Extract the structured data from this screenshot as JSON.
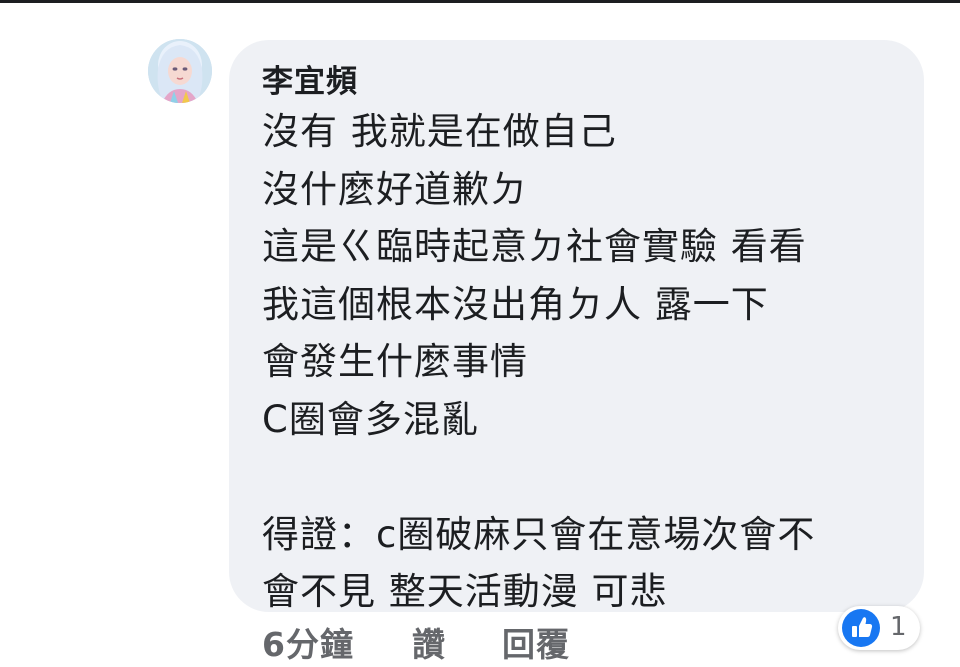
{
  "comment": {
    "author": "李宜頻",
    "lines": [
      "沒有 我就是在做自己",
      "沒什麼好道歉ㄉ",
      "這是ㄍ臨時起意ㄉ社會實驗 看看",
      "我這個根本沒出角ㄉ人 露一下",
      "會發生什麼事情",
      "C圈會多混亂",
      "",
      "得證：c圈破麻只會在意場次會不",
      "會不見 整天活動漫 可悲"
    ]
  },
  "actions": {
    "timestamp": "6分鐘",
    "like_label": "讚",
    "reply_label": "回覆"
  },
  "reactions": {
    "icon": "like-icon",
    "count": "1",
    "color": "#1877f2"
  },
  "colors": {
    "bubble": "#eff1f5",
    "text": "#1c1e21",
    "secondary_text": "#65676b"
  }
}
